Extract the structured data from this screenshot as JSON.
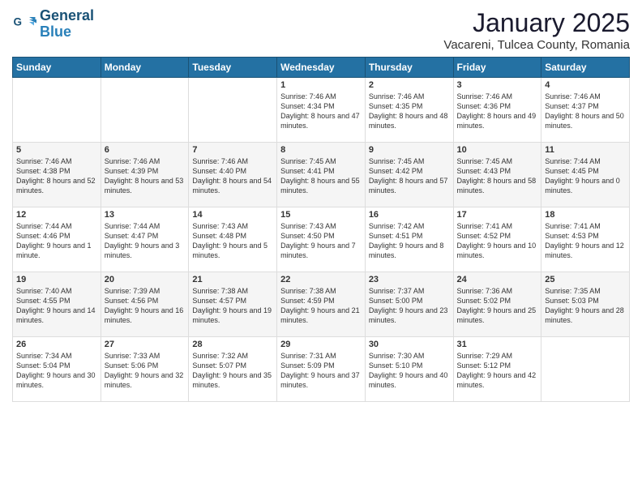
{
  "header": {
    "logo_line1": "General",
    "logo_line2": "Blue",
    "month_title": "January 2025",
    "subtitle": "Vacareni, Tulcea County, Romania"
  },
  "weekdays": [
    "Sunday",
    "Monday",
    "Tuesday",
    "Wednesday",
    "Thursday",
    "Friday",
    "Saturday"
  ],
  "weeks": [
    [
      {
        "date": "",
        "text": ""
      },
      {
        "date": "",
        "text": ""
      },
      {
        "date": "",
        "text": ""
      },
      {
        "date": "1",
        "text": "Sunrise: 7:46 AM\nSunset: 4:34 PM\nDaylight: 8 hours and 47 minutes."
      },
      {
        "date": "2",
        "text": "Sunrise: 7:46 AM\nSunset: 4:35 PM\nDaylight: 8 hours and 48 minutes."
      },
      {
        "date": "3",
        "text": "Sunrise: 7:46 AM\nSunset: 4:36 PM\nDaylight: 8 hours and 49 minutes."
      },
      {
        "date": "4",
        "text": "Sunrise: 7:46 AM\nSunset: 4:37 PM\nDaylight: 8 hours and 50 minutes."
      }
    ],
    [
      {
        "date": "5",
        "text": "Sunrise: 7:46 AM\nSunset: 4:38 PM\nDaylight: 8 hours and 52 minutes."
      },
      {
        "date": "6",
        "text": "Sunrise: 7:46 AM\nSunset: 4:39 PM\nDaylight: 8 hours and 53 minutes."
      },
      {
        "date": "7",
        "text": "Sunrise: 7:46 AM\nSunset: 4:40 PM\nDaylight: 8 hours and 54 minutes."
      },
      {
        "date": "8",
        "text": "Sunrise: 7:45 AM\nSunset: 4:41 PM\nDaylight: 8 hours and 55 minutes."
      },
      {
        "date": "9",
        "text": "Sunrise: 7:45 AM\nSunset: 4:42 PM\nDaylight: 8 hours and 57 minutes."
      },
      {
        "date": "10",
        "text": "Sunrise: 7:45 AM\nSunset: 4:43 PM\nDaylight: 8 hours and 58 minutes."
      },
      {
        "date": "11",
        "text": "Sunrise: 7:44 AM\nSunset: 4:45 PM\nDaylight: 9 hours and 0 minutes."
      }
    ],
    [
      {
        "date": "12",
        "text": "Sunrise: 7:44 AM\nSunset: 4:46 PM\nDaylight: 9 hours and 1 minute."
      },
      {
        "date": "13",
        "text": "Sunrise: 7:44 AM\nSunset: 4:47 PM\nDaylight: 9 hours and 3 minutes."
      },
      {
        "date": "14",
        "text": "Sunrise: 7:43 AM\nSunset: 4:48 PM\nDaylight: 9 hours and 5 minutes."
      },
      {
        "date": "15",
        "text": "Sunrise: 7:43 AM\nSunset: 4:50 PM\nDaylight: 9 hours and 7 minutes."
      },
      {
        "date": "16",
        "text": "Sunrise: 7:42 AM\nSunset: 4:51 PM\nDaylight: 9 hours and 8 minutes."
      },
      {
        "date": "17",
        "text": "Sunrise: 7:41 AM\nSunset: 4:52 PM\nDaylight: 9 hours and 10 minutes."
      },
      {
        "date": "18",
        "text": "Sunrise: 7:41 AM\nSunset: 4:53 PM\nDaylight: 9 hours and 12 minutes."
      }
    ],
    [
      {
        "date": "19",
        "text": "Sunrise: 7:40 AM\nSunset: 4:55 PM\nDaylight: 9 hours and 14 minutes."
      },
      {
        "date": "20",
        "text": "Sunrise: 7:39 AM\nSunset: 4:56 PM\nDaylight: 9 hours and 16 minutes."
      },
      {
        "date": "21",
        "text": "Sunrise: 7:38 AM\nSunset: 4:57 PM\nDaylight: 9 hours and 19 minutes."
      },
      {
        "date": "22",
        "text": "Sunrise: 7:38 AM\nSunset: 4:59 PM\nDaylight: 9 hours and 21 minutes."
      },
      {
        "date": "23",
        "text": "Sunrise: 7:37 AM\nSunset: 5:00 PM\nDaylight: 9 hours and 23 minutes."
      },
      {
        "date": "24",
        "text": "Sunrise: 7:36 AM\nSunset: 5:02 PM\nDaylight: 9 hours and 25 minutes."
      },
      {
        "date": "25",
        "text": "Sunrise: 7:35 AM\nSunset: 5:03 PM\nDaylight: 9 hours and 28 minutes."
      }
    ],
    [
      {
        "date": "26",
        "text": "Sunrise: 7:34 AM\nSunset: 5:04 PM\nDaylight: 9 hours and 30 minutes."
      },
      {
        "date": "27",
        "text": "Sunrise: 7:33 AM\nSunset: 5:06 PM\nDaylight: 9 hours and 32 minutes."
      },
      {
        "date": "28",
        "text": "Sunrise: 7:32 AM\nSunset: 5:07 PM\nDaylight: 9 hours and 35 minutes."
      },
      {
        "date": "29",
        "text": "Sunrise: 7:31 AM\nSunset: 5:09 PM\nDaylight: 9 hours and 37 minutes."
      },
      {
        "date": "30",
        "text": "Sunrise: 7:30 AM\nSunset: 5:10 PM\nDaylight: 9 hours and 40 minutes."
      },
      {
        "date": "31",
        "text": "Sunrise: 7:29 AM\nSunset: 5:12 PM\nDaylight: 9 hours and 42 minutes."
      },
      {
        "date": "",
        "text": ""
      }
    ]
  ]
}
